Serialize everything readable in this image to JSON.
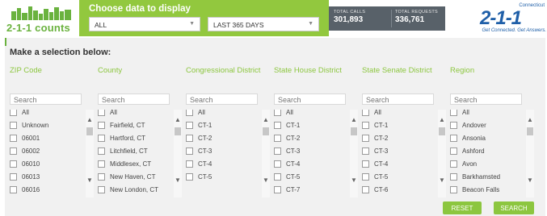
{
  "header": {
    "logo_text": "2-1-1 counts",
    "choose_label": "Choose data to display",
    "dropdown1_value": "ALL",
    "dropdown2_value": "LAST 365 DAYS",
    "total_calls_label": "TOTAL CALLS",
    "total_calls_value": "301,893",
    "total_requests_label": "TOTAL REQUESTS",
    "total_requests_value": "336,761",
    "brand_top": "Connecticut",
    "brand_big": "2-1-1",
    "brand_tagline": "Get Connected. Get Answers."
  },
  "panel": {
    "heading": "Make a selection below:",
    "columns": [
      {
        "title": "ZIP Code",
        "search_placeholder": "Search",
        "items": [
          "All",
          "Unknown",
          "06001",
          "06002",
          "06010",
          "06013",
          "06016"
        ]
      },
      {
        "title": "County",
        "search_placeholder": "Search",
        "items": [
          "All",
          "Fairfield, CT",
          "Hartford, CT",
          "Litchfield, CT",
          "Middlesex, CT",
          "New Haven, CT",
          "New London, CT"
        ]
      },
      {
        "title": "Congressional District",
        "search_placeholder": "Search",
        "items": [
          "All",
          "CT-1",
          "CT-2",
          "CT-3",
          "CT-4",
          "CT-5"
        ]
      },
      {
        "title": "State House District",
        "search_placeholder": "Search",
        "items": [
          "All",
          "CT-1",
          "CT-2",
          "CT-3",
          "CT-4",
          "CT-5",
          "CT-7"
        ]
      },
      {
        "title": "State Senate District",
        "search_placeholder": "Search",
        "items": [
          "All",
          "CT-1",
          "CT-2",
          "CT-3",
          "CT-4",
          "CT-5",
          "CT-6"
        ]
      },
      {
        "title": "Region",
        "search_placeholder": "Search",
        "items": [
          "All",
          "Andover",
          "Ansonia",
          "Ashford",
          "Avon",
          "Barkhamsted",
          "Beacon Falls"
        ]
      }
    ],
    "reset_label": "RESET",
    "search_label": "SEARCH"
  },
  "colors": {
    "brand_green": "#92c83e",
    "stats_bg": "#586169",
    "brand_blue": "#1f5fa8",
    "title_green": "#8cc63f"
  }
}
